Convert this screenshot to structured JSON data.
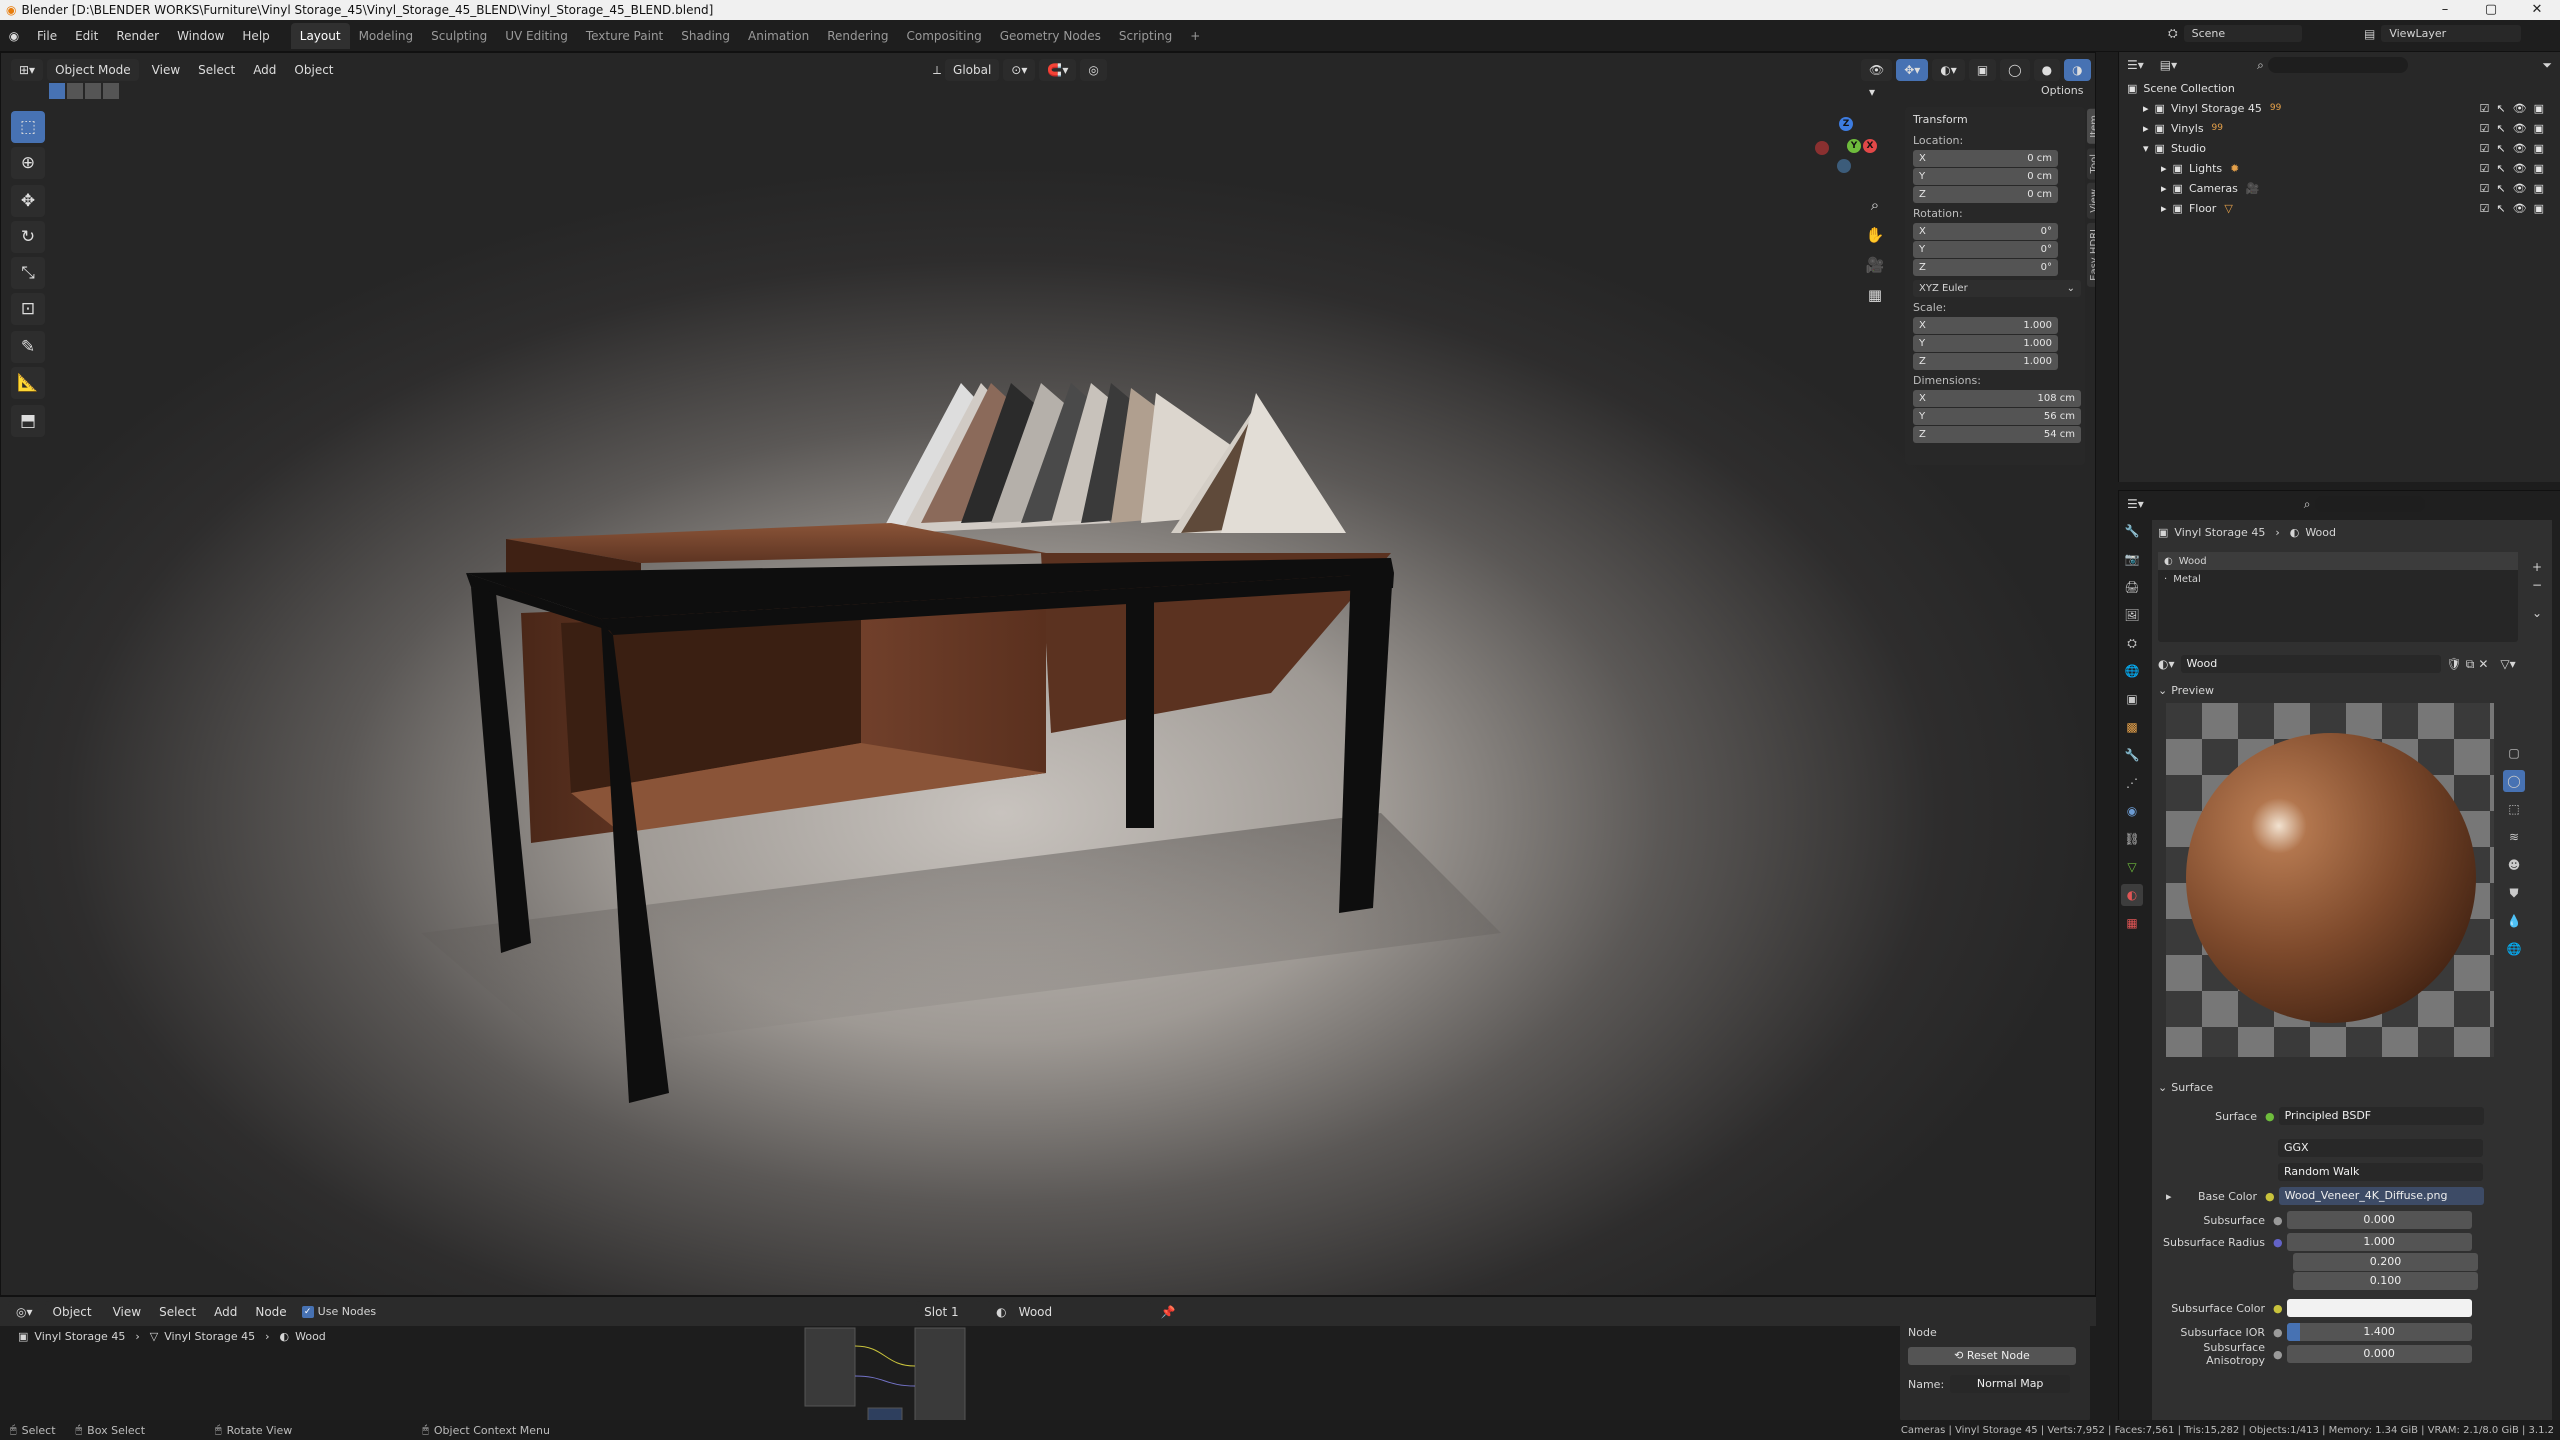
{
  "title": "Blender [D:\\BLENDER WORKS\\Furniture\\Vinyl Storage_45\\Vinyl_Storage_45_BLEND\\Vinyl_Storage_45_BLEND.blend]",
  "menu": [
    "File",
    "Edit",
    "Render",
    "Window",
    "Help"
  ],
  "workspaces": [
    "Layout",
    "Modeling",
    "Sculpting",
    "UV Editing",
    "Texture Paint",
    "Shading",
    "Animation",
    "Rendering",
    "Compositing",
    "Geometry Nodes",
    "Scripting",
    "+"
  ],
  "scene_label": "Scene",
  "viewlayer_label": "ViewLayer",
  "viewport": {
    "mode": "Object Mode",
    "menus": [
      "View",
      "Select",
      "Add",
      "Object"
    ],
    "orientation": "Global",
    "options": "Options"
  },
  "npanel": {
    "header": "Transform",
    "location_label": "Location:",
    "location": [
      [
        "X",
        "0 cm"
      ],
      [
        "Y",
        "0 cm"
      ],
      [
        "Z",
        "0 cm"
      ]
    ],
    "rotation_label": "Rotation:",
    "rotation": [
      [
        "X",
        "0°"
      ],
      [
        "Y",
        "0°"
      ],
      [
        "Z",
        "0°"
      ]
    ],
    "rotation_mode": "XYZ Euler",
    "scale_label": "Scale:",
    "scale": [
      [
        "X",
        "1.000"
      ],
      [
        "Y",
        "1.000"
      ],
      [
        "Z",
        "1.000"
      ]
    ],
    "dimensions_label": "Dimensions:",
    "dimensions": [
      [
        "X",
        "108 cm"
      ],
      [
        "Y",
        "56 cm"
      ],
      [
        "Z",
        "54 cm"
      ]
    ],
    "tabs": [
      "Item",
      "Tool",
      "View",
      "Easy HDRI"
    ]
  },
  "outliner": {
    "root": "Scene Collection",
    "items": [
      {
        "name": "Vinyl Storage 45",
        "badge": "99",
        "indent": 1
      },
      {
        "name": "Vinyls",
        "badge": "99",
        "indent": 1
      },
      {
        "name": "Studio",
        "badge": "",
        "indent": 1
      },
      {
        "name": "Lights",
        "badge": "",
        "indent": 2
      },
      {
        "name": "Cameras",
        "badge": "",
        "indent": 2
      },
      {
        "name": "Floor",
        "badge": "",
        "indent": 2
      }
    ]
  },
  "properties": {
    "breadcrumb_object": "Vinyl Storage 45",
    "breadcrumb_material": "Wood",
    "slots": [
      "Wood",
      "Metal"
    ],
    "material_name": "Wood",
    "preview_label": "Preview",
    "surface_section": "Surface",
    "surface_label": "Surface",
    "surface_value": "Principled BSDF",
    "distribution": "GGX",
    "subsurface_method": "Random Walk",
    "fields": [
      {
        "label": "Base Color",
        "value": "Wood_Veneer_4K_Diffuse.png"
      },
      {
        "label": "Subsurface",
        "value": "0.000"
      },
      {
        "label": "Subsurface Radius",
        "value": "1.000"
      },
      {
        "label": "",
        "value": "0.200"
      },
      {
        "label": "",
        "value": "0.100"
      },
      {
        "label": "Subsurface Color",
        "value": ""
      },
      {
        "label": "Subsurface IOR",
        "value": "1.400"
      },
      {
        "label": "Subsurface Anisotropy",
        "value": "0.000"
      }
    ],
    "subsurface_ior_fill": 0.07
  },
  "node_editor": {
    "mode": "Object",
    "menus": [
      "View",
      "Select",
      "Add",
      "Node"
    ],
    "use_nodes": "Use Nodes",
    "slot": "Slot 1",
    "material": "Wood",
    "breadcrumb": [
      "Vinyl Storage 45",
      "Vinyl Storage 45",
      "Wood"
    ],
    "panel_header": "Node",
    "reset_node": "Reset Node",
    "name_label": "Name:",
    "name_value": "Normal Map"
  },
  "status": {
    "select": "Select",
    "box_select": "Box Select",
    "rotate_view": "Rotate View",
    "context_menu": "Object Context Menu",
    "stats": "Cameras | Vinyl Storage 45 | Verts:7,952 | Faces:7,561 | Tris:15,282 | Objects:1/413 | Memory: 1.34 GiB | VRAM: 2.1/8.0 GiB | 3.1.2"
  },
  "colors": {
    "accent": "#4772b3",
    "panel": "#303030",
    "wood": "#6b3e26",
    "metal": "#111111"
  }
}
